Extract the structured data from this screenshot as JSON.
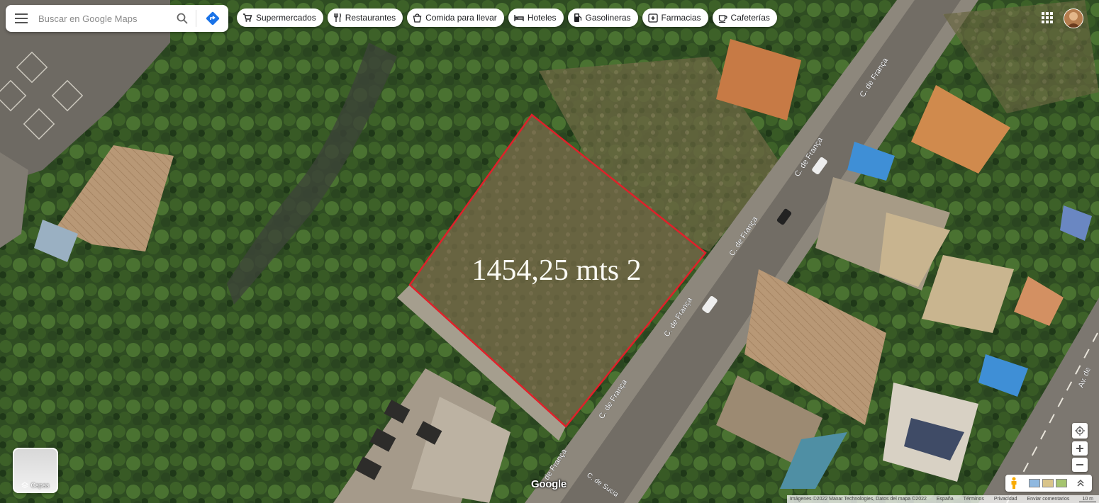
{
  "search": {
    "placeholder": "Buscar en Google Maps"
  },
  "chips": [
    {
      "label": "Supermercados",
      "icon": "cart-icon"
    },
    {
      "label": "Restaurantes",
      "icon": "fork-knife-icon"
    },
    {
      "label": "Comida para llevar",
      "icon": "takeout-icon"
    },
    {
      "label": "Hoteles",
      "icon": "bed-icon"
    },
    {
      "label": "Gasolineras",
      "icon": "gas-pump-icon"
    },
    {
      "label": "Farmacias",
      "icon": "pharmacy-icon"
    },
    {
      "label": "Cafeterías",
      "icon": "coffee-icon"
    }
  ],
  "map": {
    "area_label": "1454,25 mts 2",
    "outline_color": "#e0202a",
    "street_labels": [
      "C. de França",
      "C. de França",
      "C. de França",
      "C. de França",
      "C. de França",
      "C. de França",
      "Av. de",
      "C. de Sucia"
    ]
  },
  "layers": {
    "label": "Capas"
  },
  "brand": {
    "logo": "Google"
  },
  "footer": {
    "imagery": "Imágenes ©2022 Maxar Technologies, Datos del mapa ©2022",
    "country": "España",
    "terms": "Términos",
    "privacy": "Privacidad",
    "feedback": "Enviar comentarios",
    "scale": "10 m"
  }
}
